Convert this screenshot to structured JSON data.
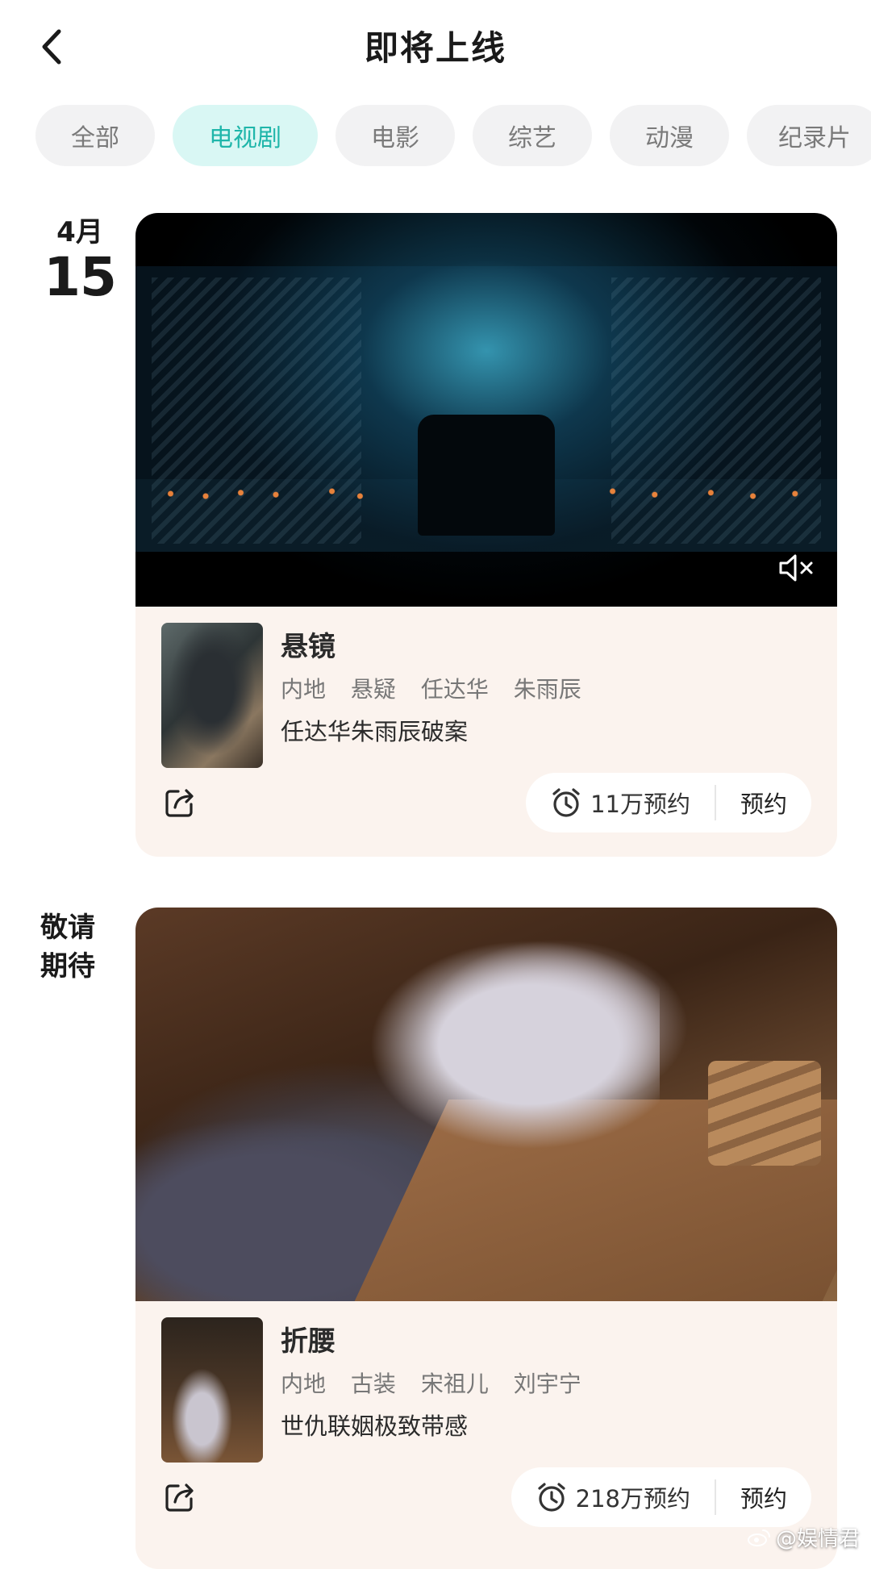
{
  "header": {
    "title": "即将上线"
  },
  "tabs": [
    {
      "label": "全部",
      "active": false
    },
    {
      "label": "电视剧",
      "active": true
    },
    {
      "label": "电影",
      "active": false
    },
    {
      "label": "综艺",
      "active": false
    },
    {
      "label": "动漫",
      "active": false
    },
    {
      "label": "纪录片",
      "active": false
    }
  ],
  "groups": [
    {
      "date": {
        "month": "4月",
        "day": "15"
      },
      "show": {
        "title": "悬镜",
        "tags": [
          "内地",
          "悬疑",
          "任达华",
          "朱雨辰"
        ],
        "description": "任达华朱雨辰破案",
        "reservation_count": "11万预约",
        "reserve_label": "预约"
      }
    },
    {
      "side_label": [
        "敬请",
        "期待"
      ],
      "show": {
        "title": "折腰",
        "tags": [
          "内地",
          "古装",
          "宋祖儿",
          "刘宇宁"
        ],
        "description": "世仇联姻极致带感",
        "reservation_count": "218万预约",
        "reserve_label": "预约"
      }
    }
  ],
  "watermark": "@娱情君",
  "colors": {
    "accent": "#1fb6aa",
    "accent_bg": "#d9f7f4",
    "card_bg": "#fbf3ee"
  }
}
